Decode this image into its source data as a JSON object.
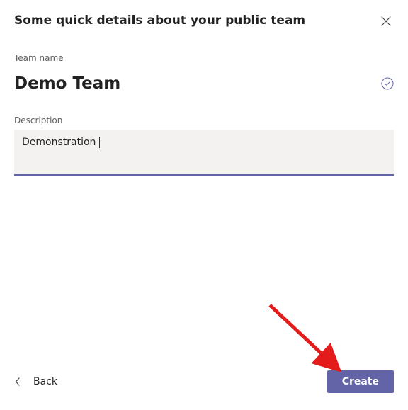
{
  "title": "Some quick details about your public team",
  "teamName": {
    "label": "Team name",
    "value": "Demo Team"
  },
  "description": {
    "label": "Description",
    "value": "Demonstration"
  },
  "footer": {
    "back": "Back",
    "create": "Create"
  },
  "colors": {
    "accent": "#6264a7"
  }
}
